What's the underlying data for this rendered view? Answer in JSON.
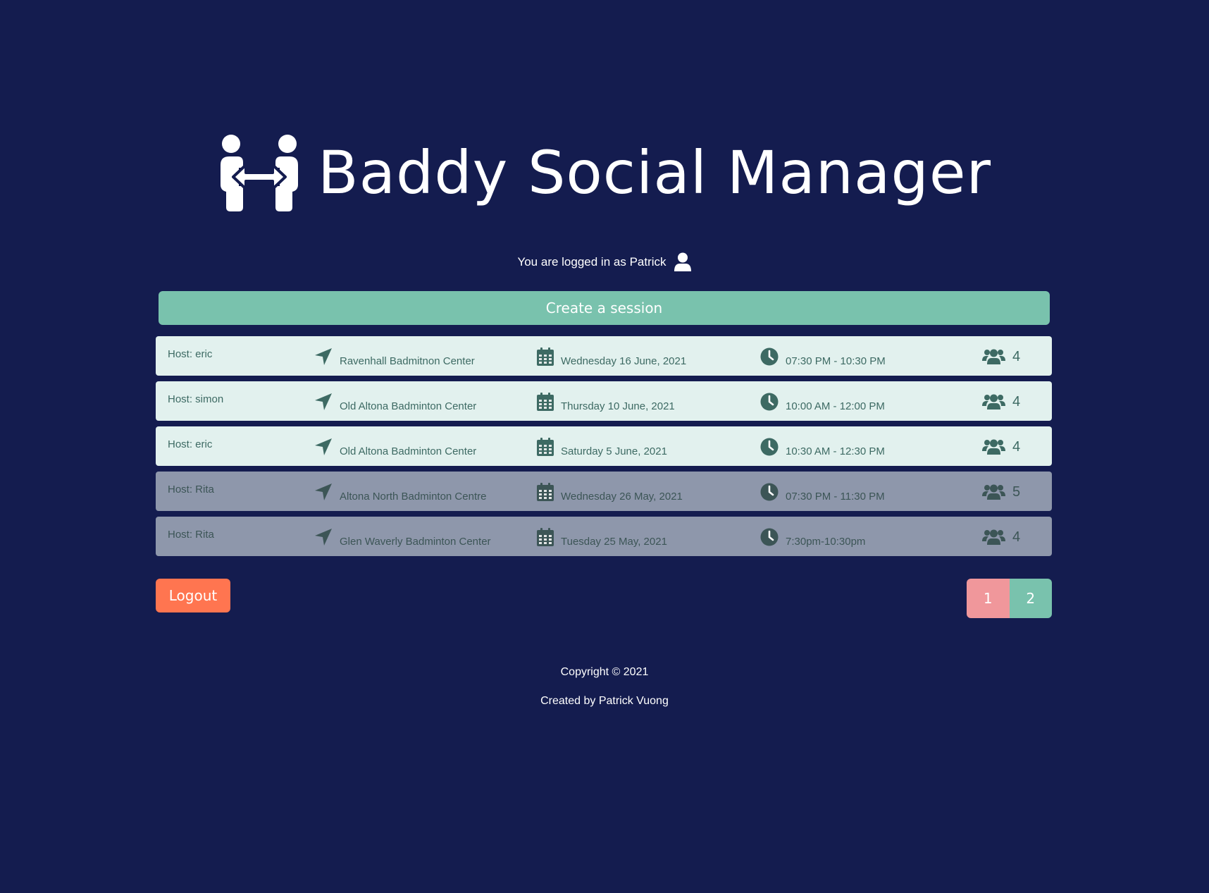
{
  "app": {
    "title": "Baddy Social Manager",
    "logo_icon": "people-arrows-icon"
  },
  "user": {
    "status_text": "You are logged in as Patrick",
    "icon": "user-icon"
  },
  "actions": {
    "create_label": "Create a session",
    "logout_label": "Logout"
  },
  "sessions": [
    {
      "host": "Host: eric",
      "location": "Ravenhall Badmitnon Center",
      "date": "Wednesday 16 June, 2021",
      "time": "07:30 PM - 10:30 PM",
      "players": "4",
      "state": "upcoming"
    },
    {
      "host": "Host: simon",
      "location": "Old Altona Badminton Center",
      "date": "Thursday 10 June, 2021",
      "time": "10:00 AM - 12:00 PM",
      "players": "4",
      "state": "upcoming"
    },
    {
      "host": "Host: eric",
      "location": "Old Altona Badminton Center",
      "date": "Saturday 5 June, 2021",
      "time": "10:30 AM - 12:30 PM",
      "players": "4",
      "state": "upcoming"
    },
    {
      "host": "Host: Rita",
      "location": "Altona North Badminton Centre",
      "date": "Wednesday 26 May, 2021",
      "time": "07:30 PM - 11:30 PM",
      "players": "5",
      "state": "past"
    },
    {
      "host": "Host: Rita",
      "location": "Glen Waverly Badminton Center",
      "date": "Tuesday 25 May, 2021",
      "time": "7:30pm-10:30pm",
      "players": "4",
      "state": "past"
    }
  ],
  "row_icons": {
    "location": "location-arrow-icon",
    "date": "calendar-icon",
    "time": "clock-icon",
    "players": "users-icon"
  },
  "pagination": {
    "pages": [
      "1",
      "2"
    ]
  },
  "footer": {
    "copyright": "Copyright © 2021",
    "credit": "Created by Patrick Vuong"
  },
  "colors": {
    "background": "#141c4f",
    "accent_green": "#79c2ad",
    "logout_orange": "#ff7550",
    "page_pink": "#f0979b",
    "row_upcoming": "#e2f1ee",
    "row_past": "#8e97ab",
    "row_text": "#3d6a63"
  }
}
